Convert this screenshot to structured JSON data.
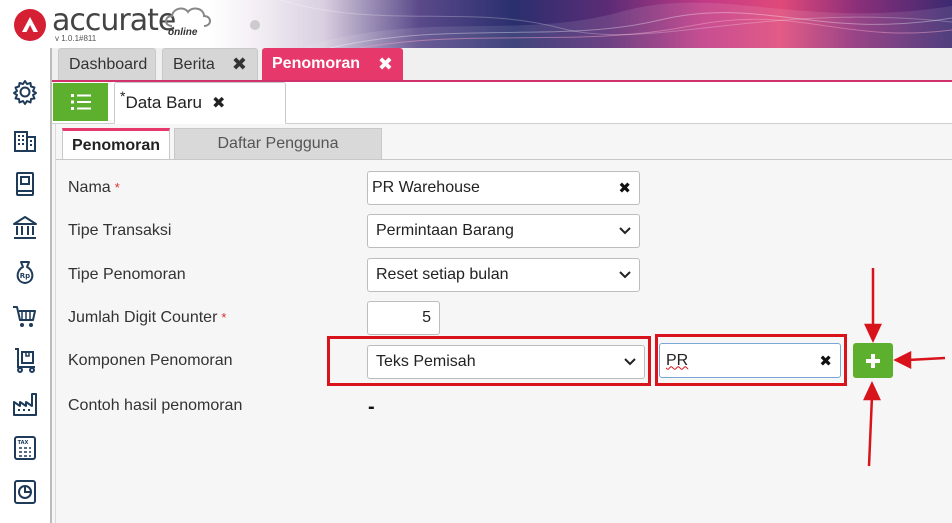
{
  "app": {
    "name": "accurate",
    "tagline": "online",
    "version": "v 1.0.1#811"
  },
  "sidebar": {
    "items": [
      {
        "icon": "gear-icon"
      },
      {
        "icon": "building-icon"
      },
      {
        "icon": "book-icon"
      },
      {
        "icon": "bank-icon"
      },
      {
        "icon": "money-bag-icon"
      },
      {
        "icon": "shopping-cart-icon"
      },
      {
        "icon": "hand-truck-icon"
      },
      {
        "icon": "factory-icon"
      },
      {
        "icon": "tax-calculator-icon"
      },
      {
        "icon": "report-chart-icon"
      }
    ]
  },
  "top_tabs": [
    {
      "label": "Dashboard",
      "closable": false
    },
    {
      "label": "Berita",
      "closable": true
    },
    {
      "label": "Penomoran",
      "closable": true,
      "active": true
    }
  ],
  "doc_tab": {
    "modified_marker": "*",
    "label": "Data Baru"
  },
  "inner_tabs": [
    {
      "label": "Penomoran",
      "active": true
    },
    {
      "label": "Daftar Pengguna",
      "active": false
    }
  ],
  "form": {
    "required_marker": "*",
    "nama": {
      "label": "Nama",
      "value": "PR Warehouse"
    },
    "tipe_transaksi": {
      "label": "Tipe Transaksi",
      "value": "Permintaan Barang"
    },
    "tipe_penomoran": {
      "label": "Tipe Penomoran",
      "value": "Reset setiap bulan"
    },
    "jumlah_digit": {
      "label": "Jumlah Digit Counter",
      "value": "5"
    },
    "komponen": {
      "label": "Komponen Penomoran",
      "type_value": "Teks Pemisah",
      "text_value": "PR"
    },
    "contoh": {
      "label": "Contoh hasil penomoran",
      "value": "-"
    }
  },
  "colors": {
    "accent": "#e7386c",
    "primary_green": "#5cb02e",
    "annotation_red": "#d8131b",
    "brand_red": "#d51f33"
  }
}
